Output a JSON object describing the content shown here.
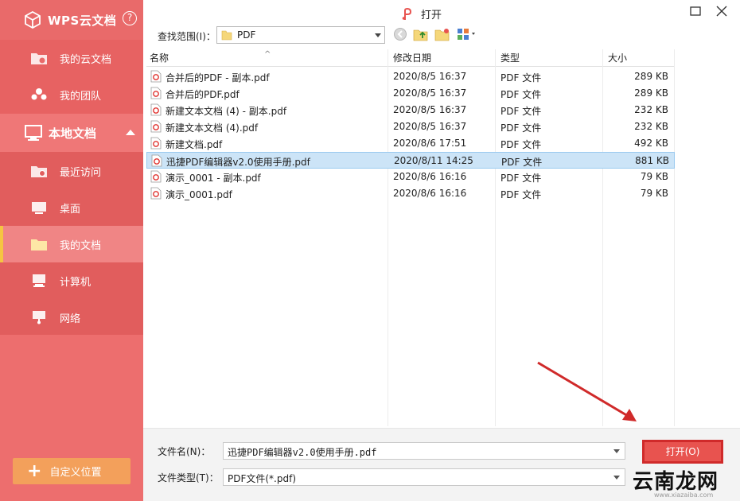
{
  "sidebar": {
    "brand": "WPS云文档",
    "help": "?",
    "items": [
      {
        "label": "我的云文档",
        "icon": "cloud-folder-icon"
      },
      {
        "label": "我的团队",
        "icon": "team-icon"
      }
    ],
    "section": {
      "label": "本地文档",
      "icon": "monitor-icon"
    },
    "local_items": [
      {
        "label": "最近访问",
        "icon": "recent-folder-icon"
      },
      {
        "label": "桌面",
        "icon": "desktop-icon"
      },
      {
        "label": "我的文档",
        "icon": "folder-icon",
        "selected": true
      },
      {
        "label": "计算机",
        "icon": "computer-icon"
      },
      {
        "label": "网络",
        "icon": "network-icon"
      }
    ],
    "custom_location": "自定义位置"
  },
  "dialog": {
    "title": "打开",
    "look_in_label": "查找范围(I)：",
    "look_in_value": "PDF"
  },
  "list": {
    "columns": [
      "名称",
      "修改日期",
      "类型",
      "大小"
    ],
    "rows": [
      {
        "name": "合并后的PDF - 副本.pdf",
        "date": "2020/8/5 16:37",
        "type": "PDF 文件",
        "size": "289 KB"
      },
      {
        "name": "合并后的PDF.pdf",
        "date": "2020/8/5 16:37",
        "type": "PDF 文件",
        "size": "289 KB"
      },
      {
        "name": "新建文本文档 (4) - 副本.pdf",
        "date": "2020/8/5 16:37",
        "type": "PDF 文件",
        "size": "232 KB"
      },
      {
        "name": "新建文本文档 (4).pdf",
        "date": "2020/8/5 16:37",
        "type": "PDF 文件",
        "size": "232 KB"
      },
      {
        "name": "新建文档.pdf",
        "date": "2020/8/6 17:51",
        "type": "PDF 文件",
        "size": "492 KB"
      },
      {
        "name": "迅捷PDF编辑器v2.0使用手册.pdf",
        "date": "2020/8/11 14:25",
        "type": "PDF 文件",
        "size": "881 KB",
        "selected": true
      },
      {
        "name": "演示_0001 - 副本.pdf",
        "date": "2020/8/6 16:16",
        "type": "PDF 文件",
        "size": "79 KB"
      },
      {
        "name": "演示_0001.pdf",
        "date": "2020/8/6 16:16",
        "type": "PDF 文件",
        "size": "79 KB"
      }
    ]
  },
  "bottom": {
    "filename_label": "文件名(N)：",
    "filename_value": "迅捷PDF编辑器v2.0使用手册.pdf",
    "filetype_label": "文件类型(T)：",
    "filetype_value": "PDF文件(*.pdf)",
    "open_button": "打开(O)"
  },
  "watermark": {
    "text": "云南龙网",
    "sub": "www.xiazaiba.com"
  },
  "colors": {
    "sidebar": "#e96a6a",
    "accent": "#f5c542",
    "selection": "#cce4f7",
    "open_button": "#e8534f",
    "annotation": "#d02a2a"
  }
}
